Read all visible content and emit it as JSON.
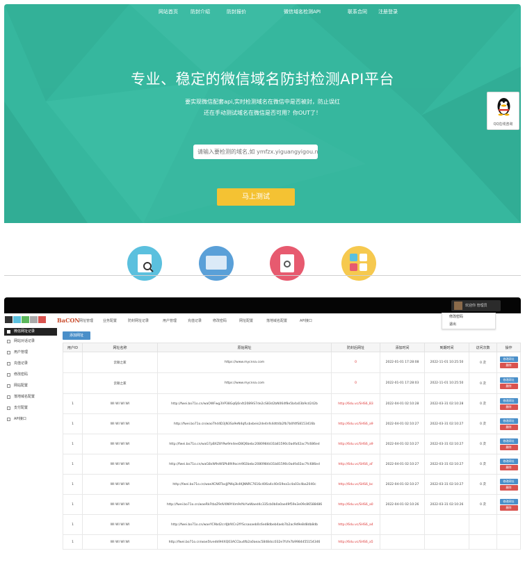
{
  "landing": {
    "nav": [
      "网站首页",
      "防封介绍",
      "防封报价",
      "微信域名检测API",
      "联系合同",
      "注册登录"
    ],
    "headline": "专业、稳定的微信域名防封检测API平台",
    "subline1": "要实现微信配套api,实时检测域名在微信中是否被封，防止误红",
    "subline2": "还在手动测试域名在微信是否可用？你OUT了！",
    "search_placeholder": "请输入要检测的域名,如 ymfzx.yiguangyigou.net",
    "test_button": "马上测试",
    "qq_label": "QQ在线咨询",
    "feature_icons": [
      "search-document-icon",
      "monitor-icon",
      "document-icon",
      "apps-icon"
    ]
  },
  "admin": {
    "brand": "BaCON",
    "user": "欢迎你 管理员",
    "dropdown": [
      "修改密码",
      "退出"
    ],
    "tabs": [
      "网址管理",
      "业务配置",
      "防封网址记录",
      "用户管理",
      "充值记录",
      "修改密码",
      "网址配置",
      "落地域名配置",
      "API接口"
    ],
    "sidebar": [
      "微信网址记录",
      "网站对话记录",
      "用户管理",
      "充值记录",
      "修改密码",
      "网站配置",
      "落地域名配置",
      "支付配置",
      "API接口"
    ],
    "add_button": "添加网址",
    "columns": [
      "用户ID",
      "网址名称",
      "原始网址",
      "防封后网址",
      "添加时间",
      "到期时间",
      "访问次数",
      "操作"
    ],
    "rows": [
      {
        "uid": "",
        "name": "云联之家",
        "url": "https://www.mycnna.com",
        "short": "0",
        "added": "2022-01-01 17:28:08",
        "expire": "2022-11-01 10:25:50",
        "visits": "0 次"
      },
      {
        "uid": "",
        "name": "云联之家",
        "url": "https://www.mycnna.com",
        "short": "0",
        "added": "2022-01-01 17:28:03",
        "expire": "2022-11-01 10:25:50",
        "visits": "0 次"
      },
      {
        "uid": "1",
        "name": "WI WI WI WI",
        "url": "http://fwei.bo71o.cn/waOWFwg3VP38Gq6j6n4t2089iS7de2cS83d2bN064f8e5b4a03b9cd242b",
        "short": "http://6du.vc/SHS6_B3",
        "added": "2022-04-01 02:10:28",
        "expire": "2022-03-31 02:10:28",
        "visits": "0 次"
      },
      {
        "uid": "1",
        "name": "WI WI WI WI",
        "url": "http://fwei.bo71o.cn/waoThd4D3jN3Sa9eN4qfLsbxbeis2de4nfs4dtt4b2fb7b0f4fS8153416b",
        "short": "http://6du.vc/SHS6_a9",
        "added": "2022-04-01 02:10:27",
        "expire": "2022-03-31 02:10:27",
        "visits": "0 次"
      },
      {
        "uid": "1",
        "name": "WI WI WI WI",
        "url": "http://fwei.bo71o.cn/waG7pBXZ8Y9w9m4eeD8Q6bebc2080984d31b81590c0adfa02ac7fc686ed",
        "short": "http://6du.vc/SHS6_a9",
        "added": "2022-04-01 02:10:27",
        "expire": "2022-03-31 02:10:27",
        "visits": "0 次"
      },
      {
        "uid": "1",
        "name": "WI WI WI WI",
        "url": "http://fwei.bo71o.cn/waG8xW9sWSPk89i9ocm902bebc2080984d31b81590c0adfa02ac7fc686ed",
        "short": "http://6du.vc/SHS6_aF",
        "added": "2022-04-01 02:10:27",
        "expire": "2022-03-31 02:10:27",
        "visits": "0 次"
      },
      {
        "uid": "1",
        "name": "WI WI WI WI",
        "url": "http://fwei.bo71o.cn/waeXCN6TbxJjPWq3k4KjNNRC7616c406a4c40d19ea1c4a03c4ba2040c",
        "short": "http://6du.vc/SHS6_bc",
        "added": "2022-04-01 02:10:27",
        "expire": "2022-03-31 02:10:27",
        "visits": "0 次"
      },
      {
        "uid": "1",
        "name": "WI WI WI WI",
        "url": "http://fwei.bo71o.cn/waeRkFtbzZ9dV4N9Y4m9dYoYwWaed4c335cb0b0a0ae49f59e3e09c86588486",
        "short": "http://6du.vc/SHS6_a0",
        "added": "2022-04-01 02:10:26",
        "expire": "2022-03-31 02:10:26",
        "visits": "0 次"
      },
      {
        "uid": "1",
        "name": "WI WI WI WI",
        "url": "http://fwei.bo71o.cn/waeYC9bd2cr4Jbf4Cn2fYScsaoaeb0c6ed8dbeb4aeb7b2ac9d9e8d8db8db",
        "short": "http://6du.vc/SHS6_a4",
        "added": "",
        "expire": "",
        "visits": ""
      },
      {
        "uid": "1",
        "name": "WI WI WI WI",
        "url": "http://fwei.bo71o.cn/wae5tvedk9HIXQ03ACCbu4fb2a0aeac5848dcc032e7fcfe7b9984455154346",
        "short": "http://6du.vc/SHS6_a5",
        "added": "",
        "expire": "",
        "visits": ""
      }
    ],
    "op_edit": "修改网址",
    "op_delete": "删除"
  },
  "colors": {
    "hero": "#36b79e",
    "button": "#f4c233",
    "topbar": "#050505",
    "accent": "#4a8fc9",
    "danger": "#d9534f"
  }
}
